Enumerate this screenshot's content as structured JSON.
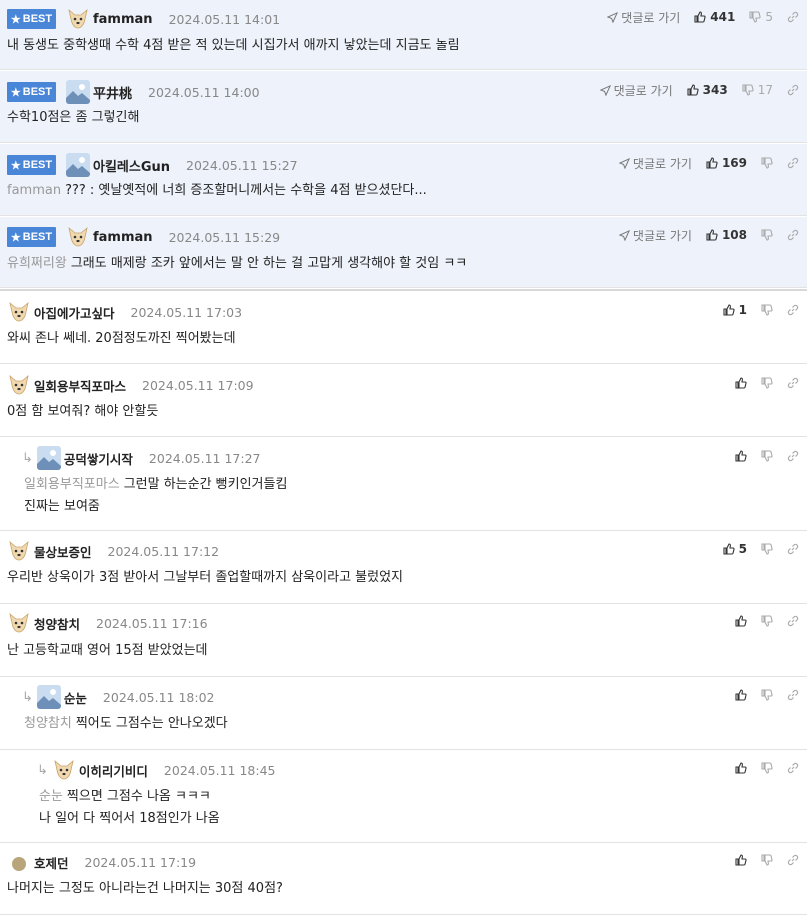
{
  "colors": {
    "best_bg": "#eef2fb",
    "badge": "#4a86d8",
    "mention": "#999999"
  },
  "best_label": "BEST",
  "goto_label": "댓글로 가기",
  "best": [
    {
      "nick": "famman",
      "date": "2024.05.11 14:01",
      "up": "441",
      "down": "5",
      "mention": "",
      "text": "내 동생도 중학생때 수학 4점 받은 적 있는데 시집가서 애까지 낳았는데 지금도 놀림",
      "avatar": "dog-icon"
    },
    {
      "nick": "平井桃",
      "date": "2024.05.11 14:00",
      "up": "343",
      "down": "17",
      "mention": "",
      "text": "수학10점은 좀 그렇긴해",
      "avatar": "photo-icon"
    },
    {
      "nick": "아킬레스Gun",
      "date": "2024.05.11 15:27",
      "up": "169",
      "down": "",
      "mention": "famman",
      "text": "??? : 옛날옛적에 너희 증조할머니께서는 수학을 4점 받으셨단다...",
      "avatar": "photo-icon"
    },
    {
      "nick": "famman",
      "date": "2024.05.11 15:29",
      "up": "108",
      "down": "",
      "mention": "유희쩌리왕",
      "text": "그래도 매제랑 조카 앞에서는 말 안 하는 걸 고맙게 생각해야 할 것임 ㅋㅋ",
      "avatar": "dog-icon"
    }
  ],
  "comments": [
    {
      "nick": "아집에가고싶다",
      "date": "2024.05.11 17:03",
      "up": "1",
      "mention": "",
      "lines": [
        "와씨 존나 쎄네. 20점정도까진 찍어봤는데"
      ],
      "avatar": "dog-icon",
      "depth": 0
    },
    {
      "nick": "일회용부직포마스",
      "date": "2024.05.11 17:09",
      "up": "",
      "mention": "",
      "lines": [
        "0점 함 보여줘? 해야 안할듯"
      ],
      "avatar": "dog-icon",
      "depth": 0
    },
    {
      "nick": "공덕쌓기시작",
      "date": "2024.05.11 17:27",
      "up": "",
      "mention": "일회용부직포마스",
      "lines": [
        "그런말 하는순간 뻥키인거들킴",
        "진짜는 보여줌"
      ],
      "avatar": "photo-icon",
      "depth": 1
    },
    {
      "nick": "물상보증인",
      "date": "2024.05.11 17:12",
      "up": "5",
      "mention": "",
      "lines": [
        "우리반 상욱이가 3점 받아서 그날부터 졸업할때까지 삼욱이라고 불렀었지"
      ],
      "avatar": "dog-icon",
      "depth": 0
    },
    {
      "nick": "청양참치",
      "date": "2024.05.11 17:16",
      "up": "",
      "mention": "",
      "lines": [
        "난 고등학교때 영어 15점 받았었는데"
      ],
      "avatar": "dog-icon",
      "depth": 0
    },
    {
      "nick": "순눈",
      "date": "2024.05.11 18:02",
      "up": "",
      "mention": "청양참치",
      "lines": [
        "찍어도 그점수는 안나오겠다"
      ],
      "avatar": "photo-icon",
      "depth": 1
    },
    {
      "nick": "이히리기비디",
      "date": "2024.05.11 18:45",
      "up": "",
      "mention": "순눈",
      "lines": [
        "찍으면 그점수 나옴 ㅋㅋㅋ",
        "나 일어 다 찍어서 18점인가 나옴"
      ],
      "avatar": "dog-icon",
      "depth": 2
    },
    {
      "nick": "호제던",
      "date": "2024.05.11 17:19",
      "up": "",
      "mention": "",
      "lines": [
        "나머지는 그정도 아니라는건 나머지는 30점 40점?"
      ],
      "avatar": "circle-icon",
      "depth": 0
    }
  ]
}
